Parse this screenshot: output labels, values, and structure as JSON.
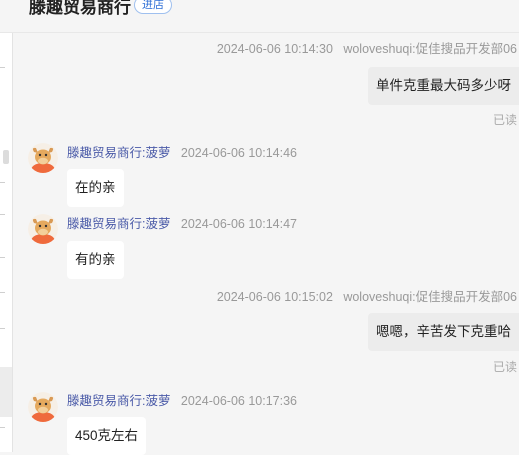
{
  "header": {
    "shop_name": "滕趣贸易商行",
    "enter_label": "进店"
  },
  "messages": [
    {
      "type": "outgoing",
      "time": "2024-06-06 10:14:30",
      "sender": "woloveshuqi:促佳搜品开发部06",
      "text": "单件克重最大码多少呀",
      "status": "已读"
    },
    {
      "type": "incoming",
      "time": "2024-06-06 10:14:46",
      "sender": "滕趣贸易商行:菠萝",
      "text": "在的亲"
    },
    {
      "type": "incoming",
      "time": "2024-06-06 10:14:47",
      "sender": "滕趣贸易商行:菠萝",
      "text": "有的亲"
    },
    {
      "type": "outgoing",
      "time": "2024-06-06 10:15:02",
      "sender": "woloveshuqi:促佳搜品开发部06",
      "text": "嗯嗯，辛苦发下克重哈",
      "status": "已读"
    },
    {
      "type": "incoming",
      "time": "2024-06-06 10:17:36",
      "sender": "滕趣贸易商行:菠萝",
      "text": "450克左右"
    }
  ],
  "avatar_icon": "bull-mascot-icon",
  "colors": {
    "sender_name": "#4a5aa8",
    "timestamp": "#999999",
    "enter_tag": "#2f6fd6"
  }
}
